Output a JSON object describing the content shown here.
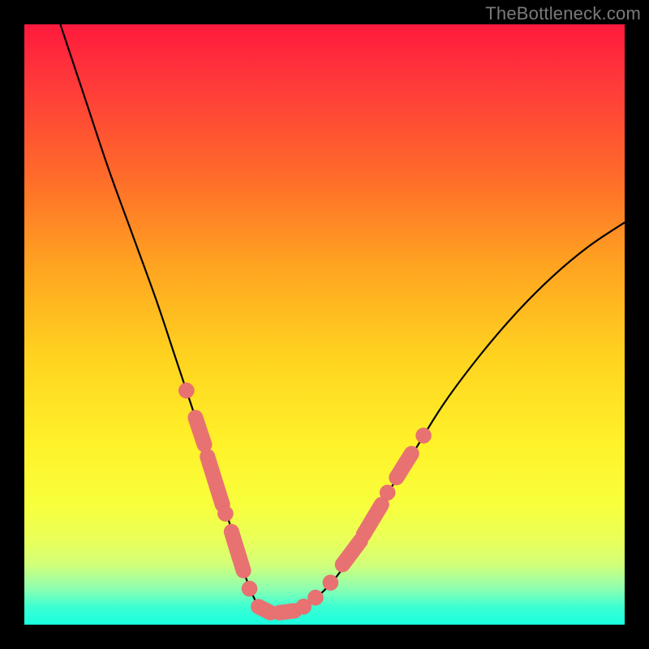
{
  "watermark": "TheBottleneck.com",
  "colors": {
    "curve": "#000000",
    "marker": "#e87272",
    "gradient_top": "#ff1a3d",
    "gradient_bottom": "#19ffe0",
    "page_bg": "#000000"
  },
  "chart_data": {
    "type": "line",
    "title": "",
    "xlabel": "",
    "ylabel": "",
    "xlim": [
      0,
      100
    ],
    "ylim": [
      0,
      100
    ],
    "grid": false,
    "legend": false,
    "series": [
      {
        "name": "bottleneck-curve",
        "x": [
          6,
          10,
          14,
          18,
          22,
          25,
          27,
          29,
          31,
          33,
          35,
          36.5,
          38,
          39.5,
          41,
          44,
          48,
          52,
          56,
          60,
          65,
          70,
          76,
          82,
          88,
          94,
          100
        ],
        "y": [
          100,
          88,
          76,
          65,
          54,
          45,
          39,
          33,
          27,
          21,
          14,
          9,
          5,
          2.5,
          2,
          2,
          4,
          8,
          14,
          21,
          29,
          37,
          45,
          52,
          58,
          63,
          67
        ]
      }
    ],
    "markers": [
      {
        "shape": "dot",
        "x": 27.0,
        "y": 39.0
      },
      {
        "shape": "capsule",
        "x1": 28.5,
        "y1": 34.5,
        "x2": 30.0,
        "y2": 30.0
      },
      {
        "shape": "capsule",
        "x1": 30.5,
        "y1": 28.0,
        "x2": 33.0,
        "y2": 20.0
      },
      {
        "shape": "dot",
        "x": 33.5,
        "y": 18.5
      },
      {
        "shape": "capsule",
        "x1": 34.5,
        "y1": 15.5,
        "x2": 36.5,
        "y2": 9.0
      },
      {
        "shape": "dot",
        "x": 37.5,
        "y": 6.0
      },
      {
        "shape": "capsule",
        "x1": 39.0,
        "y1": 3.0,
        "x2": 41.0,
        "y2": 2.0
      },
      {
        "shape": "capsule",
        "x1": 42.5,
        "y1": 2.0,
        "x2": 45.0,
        "y2": 2.3
      },
      {
        "shape": "dot",
        "x": 46.5,
        "y": 3.0
      },
      {
        "shape": "dot",
        "x": 48.5,
        "y": 4.5
      },
      {
        "shape": "dot",
        "x": 51.0,
        "y": 7.0
      },
      {
        "shape": "capsule",
        "x1": 53.0,
        "y1": 10.0,
        "x2": 56.0,
        "y2": 14.0
      },
      {
        "shape": "capsule",
        "x1": 56.5,
        "y1": 15.0,
        "x2": 59.5,
        "y2": 20.0
      },
      {
        "shape": "dot",
        "x": 60.5,
        "y": 22.0
      },
      {
        "shape": "capsule",
        "x1": 62.0,
        "y1": 24.5,
        "x2": 64.5,
        "y2": 28.5
      },
      {
        "shape": "dot",
        "x": 66.5,
        "y": 31.5
      }
    ],
    "annotations": []
  }
}
